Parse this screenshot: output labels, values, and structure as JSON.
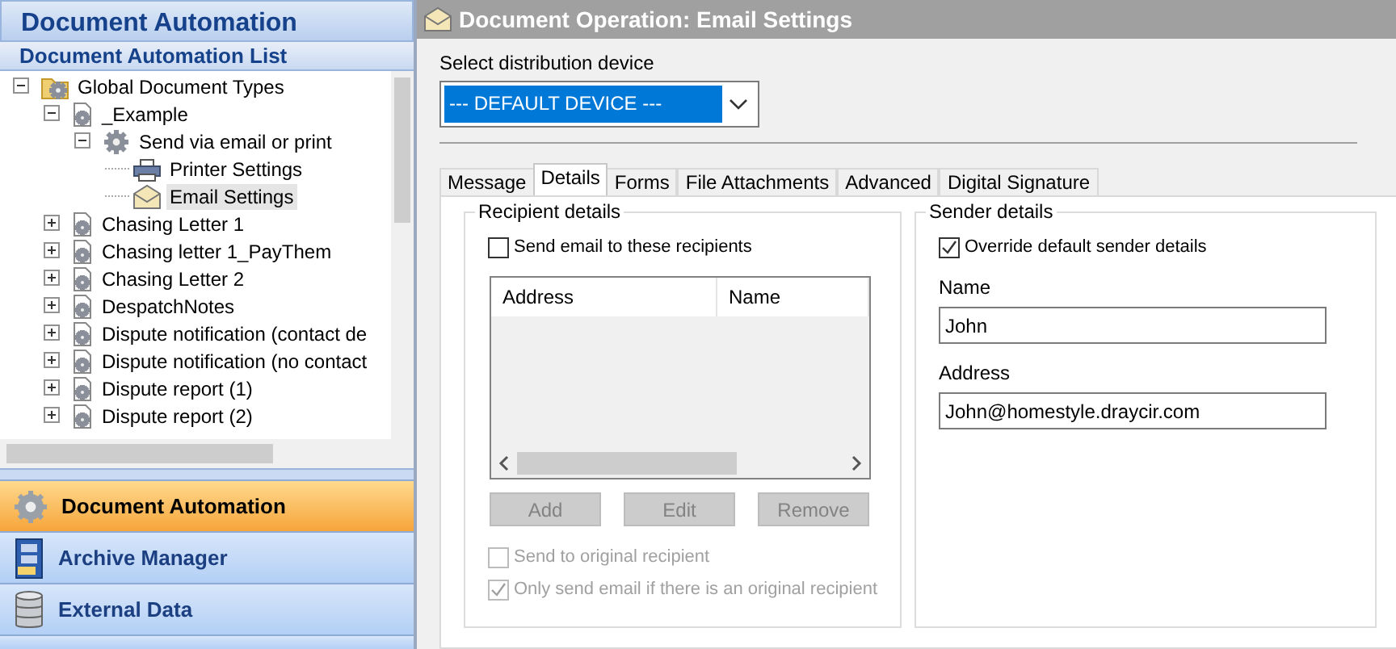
{
  "sidebar": {
    "title": "Document Automation",
    "subtitle": "Document Automation List",
    "tree": [
      {
        "label": "Global Document Types",
        "kind": "folder",
        "expanded": true,
        "selected": false,
        "children": [
          {
            "label": "_Example",
            "kind": "document",
            "expanded": true,
            "selected": false,
            "children": [
              {
                "label": "Send via email or print",
                "kind": "gear",
                "expanded": true,
                "selected": false,
                "children": [
                  {
                    "label": "Printer Settings",
                    "kind": "printer",
                    "selected": false
                  },
                  {
                    "label": "Email Settings",
                    "kind": "envelope",
                    "selected": true
                  }
                ]
              }
            ]
          },
          {
            "label": "Chasing Letter 1",
            "kind": "document",
            "expanded": false,
            "selected": false
          },
          {
            "label": "Chasing letter 1_PayThem",
            "kind": "document",
            "expanded": false,
            "selected": false
          },
          {
            "label": "Chasing Letter 2",
            "kind": "document",
            "expanded": false,
            "selected": false
          },
          {
            "label": "DespatchNotes",
            "kind": "document",
            "expanded": false,
            "selected": false
          },
          {
            "label": "Dispute notification (contact de",
            "kind": "document",
            "expanded": false,
            "selected": false
          },
          {
            "label": "Dispute notification (no contact",
            "kind": "document",
            "expanded": false,
            "selected": false
          },
          {
            "label": "Dispute report (1)",
            "kind": "document",
            "expanded": false,
            "selected": false
          },
          {
            "label": "Dispute report (2)",
            "kind": "document",
            "expanded": false,
            "selected": false
          }
        ]
      }
    ],
    "nav": [
      {
        "label": "Document Automation",
        "kind": "gear",
        "selected": true
      },
      {
        "label": "Archive Manager",
        "kind": "cabinet",
        "selected": false
      },
      {
        "label": "External Data",
        "kind": "database",
        "selected": false
      }
    ]
  },
  "main": {
    "title": "Document Operation: Email Settings",
    "device_label": "Select distribution device",
    "device": "--- DEFAULT DEVICE ---",
    "tabs": [
      {
        "label": "Message",
        "selected": false
      },
      {
        "label": "Details",
        "selected": true
      },
      {
        "label": "Forms",
        "selected": false
      },
      {
        "label": "File Attachments",
        "selected": false
      },
      {
        "label": "Advanced",
        "selected": false
      },
      {
        "label": "Digital Signature",
        "selected": false
      }
    ],
    "recipient": {
      "title": "Recipient details",
      "send_to_these": {
        "label": "Send email to these recipients",
        "checked": false,
        "disabled": false
      },
      "columns": [
        "Address",
        "Name"
      ],
      "buttons": [
        {
          "label": "Add",
          "disabled": true
        },
        {
          "label": "Edit",
          "disabled": true
        },
        {
          "label": "Remove",
          "disabled": true
        }
      ],
      "options": [
        {
          "label": "Send to original recipient",
          "checked": false,
          "disabled": true
        },
        {
          "label": "Only send email if there is an original recipient",
          "checked": true,
          "disabled": true
        }
      ]
    },
    "sender": {
      "title": "Sender details",
      "override": {
        "label": "Override default sender details",
        "checked": true,
        "disabled": false
      },
      "fields": [
        {
          "label": "Name",
          "value": "John"
        },
        {
          "label": "Address",
          "value": "John@homestyle.draycir.com"
        }
      ]
    }
  }
}
